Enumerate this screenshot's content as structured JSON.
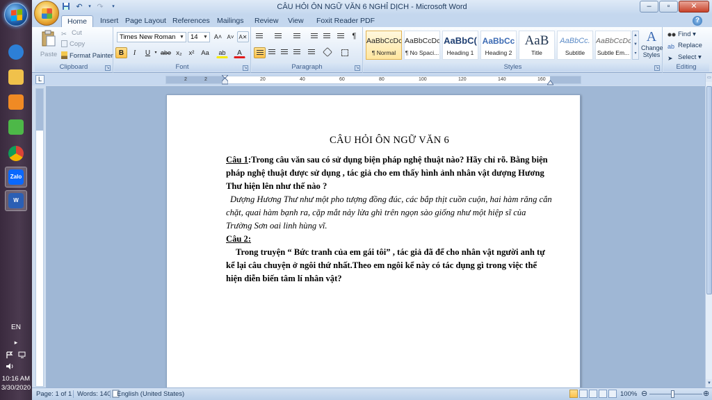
{
  "taskbar": {
    "apps": [
      {
        "name": "ie",
        "color": "#2d7fd6"
      },
      {
        "name": "explorer",
        "color": "#f0c14b"
      },
      {
        "name": "media-player",
        "color": "#f08a24"
      },
      {
        "name": "green-app",
        "color": "#4db848"
      },
      {
        "name": "chrome",
        "color": "#db4437"
      },
      {
        "name": "zalo",
        "color": "#0a68fe",
        "label": "Zalo"
      },
      {
        "name": "word",
        "color": "#2b5fb4",
        "label": "W"
      }
    ],
    "lang": "EN",
    "chevron": "▸",
    "time": "10:16 AM",
    "date": "3/30/2020"
  },
  "window": {
    "title": "CÂU HỎI ÔN NGỮ VĂN 6 NGHỈ DỊCH - Microsoft Word",
    "min": "–",
    "max": "▫",
    "close": "✕"
  },
  "tabs": [
    "Home",
    "Insert",
    "Page Layout",
    "References",
    "Mailings",
    "Review",
    "View",
    "Foxit Reader PDF"
  ],
  "help": "?",
  "clipboard": {
    "paste": "Paste",
    "cut": "Cut",
    "copy": "Copy",
    "format_painter": "Format Painter",
    "label": "Clipboard"
  },
  "font": {
    "name": "Times New Roman",
    "size": "14",
    "grow": "A˄",
    "shrink": "A˅",
    "clear": "A✕",
    "bold": "B",
    "italic": "I",
    "underline": "U",
    "strike": "abe",
    "subscript": "x₂",
    "superscript": "x²",
    "change_case": "Aa",
    "highlight": "ab",
    "font_color": "A",
    "label": "Font"
  },
  "paragraph": {
    "label": "Paragraph"
  },
  "styles": {
    "items": [
      {
        "preview": "AaBbCcDc",
        "name": "¶ Normal",
        "selected": true
      },
      {
        "preview": "AaBbCcDc",
        "name": "¶ No Spaci..."
      },
      {
        "preview": "AaBbC(",
        "name": "Heading 1"
      },
      {
        "preview": "AaBbCc",
        "name": "Heading 2"
      },
      {
        "preview": "AaB",
        "name": "Title"
      },
      {
        "preview": "AaBbCc.",
        "name": "Subtitle"
      },
      {
        "preview": "AaBbCcDc",
        "name": "Subtle Em..."
      }
    ],
    "change_styles": "Change Styles",
    "label": "Styles"
  },
  "editing": {
    "find": "Find",
    "replace": "Replace",
    "select": "Select",
    "label": "Editing"
  },
  "ruler": {
    "corner": "L",
    "ticks": [
      "2",
      "2",
      "20",
      "40",
      "60",
      "80",
      "100",
      "120",
      "140",
      "160"
    ]
  },
  "document": {
    "title": "CÂU HỎI ÔN NGỮ VĂN 6",
    "q1_label": "Câu 1",
    "q1_text": ":Trong câu văn sau có sử dụng biện pháp nghệ thuật nào? Hãy chỉ rõ. Bằng biện pháp nghệ thuật được sử dụng , tác giả cho em thấy hình ảnh nhân vật dượng Hương Thư hiện lên  như thế nào ?",
    "q1_quote": "Dượng Hương Thư như một pho tượng đồng đúc, các bắp thịt cuồn cuộn, hai hàm răng cắn chặt, quai hàm bạnh ra, cặp mắt nảy lửa ghì trên ngọn sào giống như một hiệp sĩ của Trường Sơn oai linh hùng vĩ.",
    "q2_label": "Câu 2:",
    "q2_text": "Trong truyện “ Bức tranh của em gái tôi” , tác giả đã để cho nhân vật người anh tự kể lại câu chuyện ở ngôi thứ nhất.Theo em ngôi kể này có tác dụng gì trong việc thể hiện diễn biến tâm lí nhân vật?"
  },
  "status": {
    "page": "Page: 1 of 1",
    "words": "Words: 140",
    "language": "English (United States)",
    "zoom": "100%"
  }
}
